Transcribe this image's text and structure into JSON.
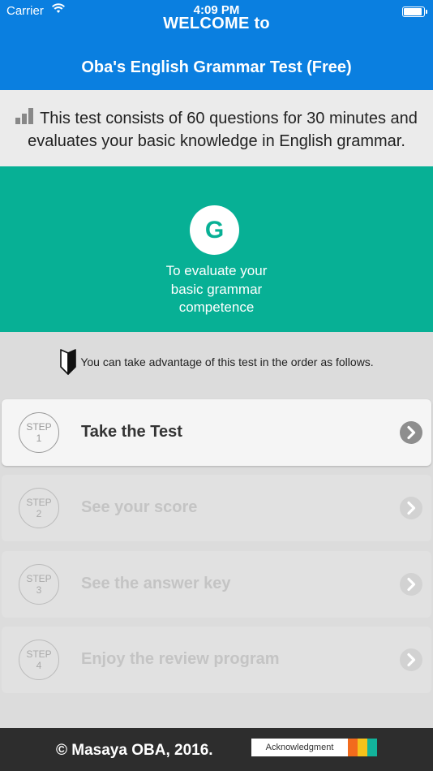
{
  "status_bar": {
    "carrier": "Carrier",
    "time": "4:09 PM",
    "battery_level": 0.95
  },
  "header": {
    "welcome": "WELCOME to",
    "title": "Oba's English Grammar Test (Free)"
  },
  "intro": {
    "icon": "bar-chart-icon",
    "text_line1": "This test consists of 60 questions for 30 minutes and",
    "text_line2": "evaluates your basic knowledge in English grammar."
  },
  "hero": {
    "letter": "G",
    "line1": "To evaluate your",
    "line2": "basic grammar",
    "line3": "competence"
  },
  "notice": {
    "icon": "beginner-leaf-icon",
    "text": "You can take advantage of this test in the order as follows."
  },
  "steps": [
    {
      "badge_word": "STEP",
      "badge_num": "1",
      "label": "Take the Test",
      "active": true
    },
    {
      "badge_word": "STEP",
      "badge_num": "2",
      "label": "See your score",
      "active": false
    },
    {
      "badge_word": "STEP",
      "badge_num": "3",
      "label": "See the answer key",
      "active": false
    },
    {
      "badge_word": "STEP",
      "badge_num": "4",
      "label": "Enjoy the review program",
      "active": false
    }
  ],
  "footer": {
    "copyright": "© Masaya OBA, 2016.",
    "acknowledgment": "Acknowledgment"
  },
  "colors": {
    "header_blue": "#0a7fe0",
    "hero_green": "#07b095",
    "footer_dark": "#2d2d2d",
    "ack_orange": "#f26b1d",
    "ack_yellow": "#f5c21b",
    "ack_teal": "#12b39b"
  }
}
